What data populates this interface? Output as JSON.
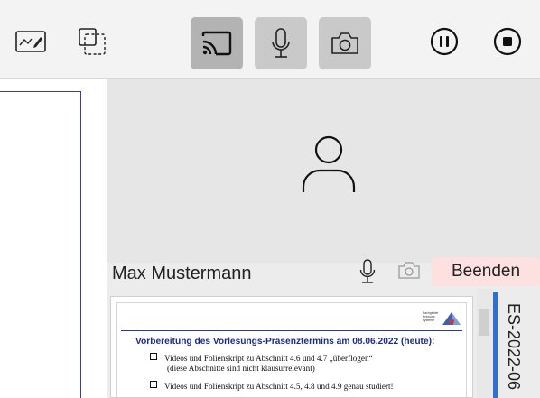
{
  "participant": {
    "name": "Max Mustermann",
    "end_label": "Beenden"
  },
  "slide": {
    "title": "Vorbereitung des Vorlesungs-Präsenztermins am 08.06.2022 (heute):",
    "logo_text": "Fachgebiet Entwurfs systeme",
    "bullets": [
      {
        "text": "Videos und Folienskript zu Abschnitt 4.6 und 4.7 „überflogen“",
        "sub": "(diese Abschnitte sind nicht klausurrelevant)"
      },
      {
        "text": "Videos und Folienskript zu Abschnitt 4.5, 4.8 und 4.9 genau studiert!",
        "sub": ""
      }
    ]
  },
  "list": {
    "item_label": "ES-2022-06"
  },
  "colors": {
    "accent": "#2f6fd1",
    "end_bg": "#fde0e0",
    "slide_title": "#1e2a8a"
  }
}
